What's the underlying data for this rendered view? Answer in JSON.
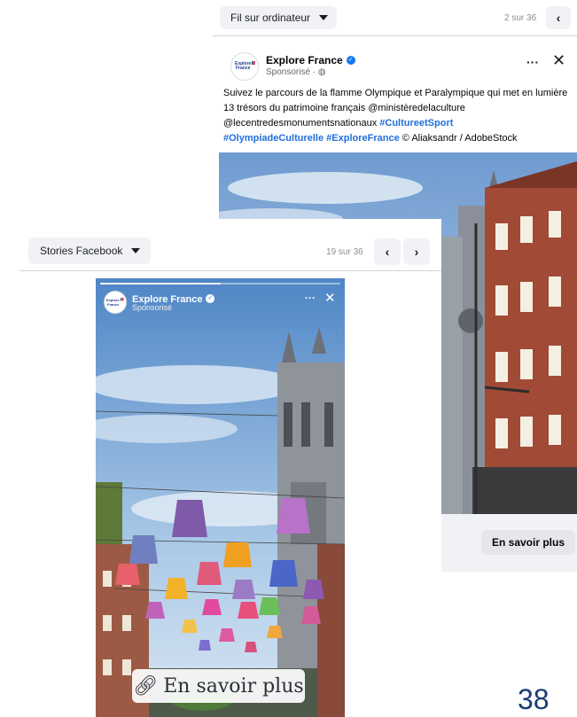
{
  "colors": {
    "accent": "#1877f2",
    "hashtag": "#216fdb",
    "page_number": "#1b3c73"
  },
  "feed": {
    "placement_label": "Fil sur ordinateur",
    "counter": "2 sur 36",
    "prev_icon": "chevron-left-icon",
    "post": {
      "page_name": "Explore France",
      "logo_text": "Explore France",
      "sponsored": "Sponsorisé · ",
      "text_main": "Suivez le parcours de la flamme Olympique et Paralympique qui met en lumière 13 trésors du patrimoine français @ministèredelaculture @lecentredesmonumentsnationaux ",
      "hashtag_1": "#CultureetSport",
      "hashtag_2": "#OlympiadeCulturelle",
      "hashtag_3": "#ExploreFrance",
      "credit": " © Aliaksandr / AdobeStock",
      "cta": "En savoir plus"
    }
  },
  "stories": {
    "placement_label": "Stories Facebook",
    "counter": "19 sur 36",
    "story": {
      "page_name": "Explore France",
      "sponsored": "Sponsorisé",
      "cta": "En savoir plus",
      "progress": 0.5
    }
  },
  "page_number": "38"
}
